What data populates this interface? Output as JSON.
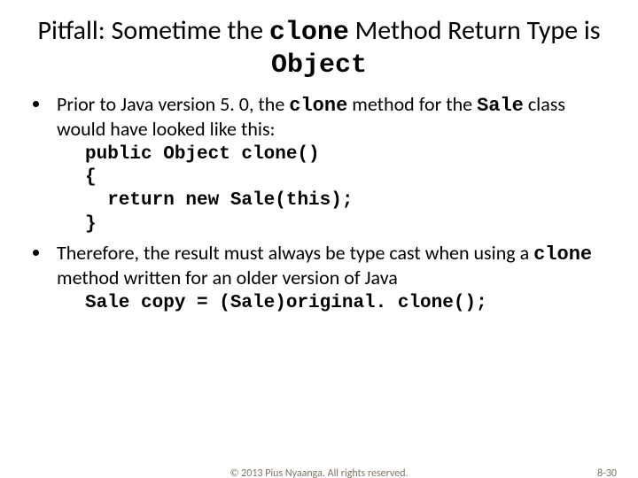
{
  "title": {
    "prefix": "Pitfall:  Sometime the ",
    "code1": "clone",
    "mid": " Method Return Type is ",
    "code2": "Object"
  },
  "bullet1": {
    "t1": "Prior to Java version 5. 0, the ",
    "c1": "clone",
    "t2": " method for the ",
    "c2": "Sale",
    "t3": " class would have looked like this:"
  },
  "code1": "public Object clone()\n{\n  return new Sale(this);\n}",
  "bullet2": {
    "t1": "Therefore, the result must always be type cast when using a ",
    "c1": "clone",
    "t2": " method written for an older version of Java"
  },
  "code2": "Sale copy = (Sale)original. clone();",
  "footer": {
    "copyright": "© 2013 Pius Nyaanga. All rights reserved.",
    "pagenum": "8-30"
  }
}
